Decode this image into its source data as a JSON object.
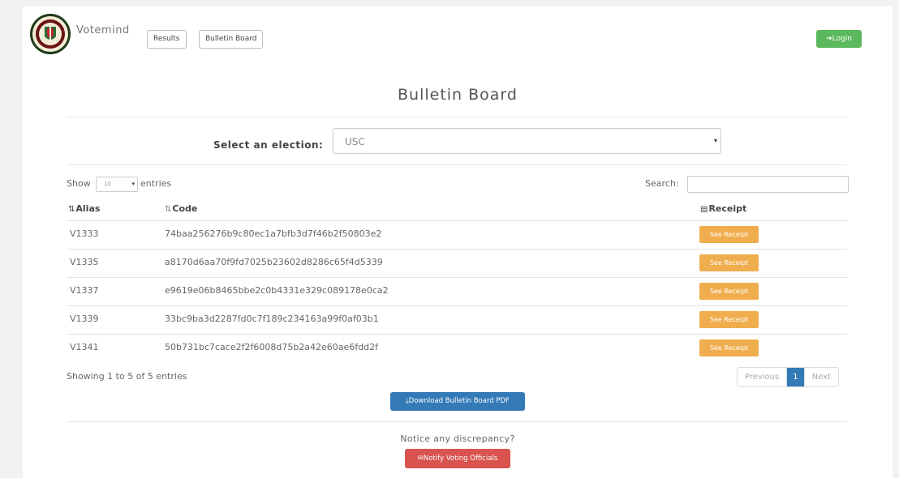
{
  "header": {
    "brand": "Votemind",
    "nav": [
      {
        "label": "Results"
      },
      {
        "label": "Bulletin Board"
      }
    ],
    "login_icon": "sign-in-icon",
    "login_label": "Login"
  },
  "main": {
    "title": "Bulletin Board",
    "election": {
      "label": "Select an election:",
      "selected": "USC"
    },
    "table_controls": {
      "show_label": "Show",
      "length_value": "10",
      "entries_label": "entries",
      "search_label": "Search:"
    },
    "table": {
      "columns": [
        "Alias",
        "Code",
        "Receipt"
      ],
      "rows": [
        {
          "alias": "V1333",
          "code": "74baa256276b9c80ec1a7bfb3d7f46b2f50803e2",
          "action": "See Receipt"
        },
        {
          "alias": "V1335",
          "code": "a8170d6aa70f9fd7025b23602d8286c65f4d5339",
          "action": "See Receipt"
        },
        {
          "alias": "V1337",
          "code": "e9619e06b8465bbe2c0b4331e329c089178e0ca2",
          "action": "See Receipt"
        },
        {
          "alias": "V1339",
          "code": "33bc9ba3d2287fd0c7f189c234163a99f0af03b1",
          "action": "See Receipt"
        },
        {
          "alias": "V1341",
          "code": "50b731bc7cace2f2f6008d75b2a42e60ae6fdd2f",
          "action": "See Receipt"
        }
      ]
    },
    "info": "Showing 1 to 5 of 5 entries",
    "pagination": {
      "previous": "Previous",
      "current": "1",
      "next": "Next"
    },
    "download_label": "Download Bulletin Board PDF",
    "notice": "Notice any discrepancy?",
    "notify_label": "Notify Voting Officials"
  },
  "colors": {
    "login": "#5cb85c",
    "primary": "#337ab7",
    "warning": "#f0ad4e",
    "danger": "#d9534f"
  }
}
